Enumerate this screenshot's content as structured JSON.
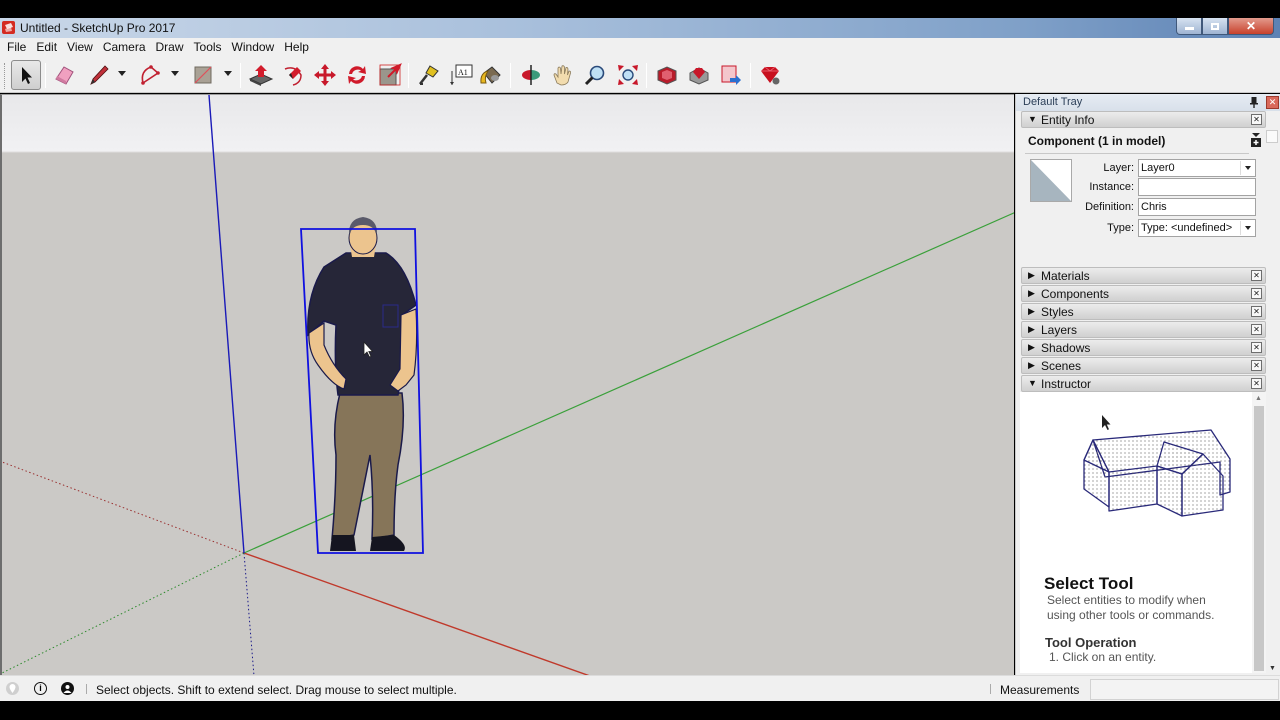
{
  "window": {
    "title": "Untitled - SketchUp Pro 2017",
    "controls": [
      "minimize",
      "restore",
      "close"
    ]
  },
  "menu": {
    "items": [
      "File",
      "Edit",
      "View",
      "Camera",
      "Draw",
      "Tools",
      "Window",
      "Help"
    ]
  },
  "toolbar": {
    "tools": [
      {
        "name": "select-tool",
        "icon": "arrow-cursor-icon",
        "active": true
      },
      {
        "name": "eraser-tool",
        "icon": "eraser-icon"
      },
      {
        "name": "line-tool",
        "icon": "pencil-icon",
        "has_dropdown": true
      },
      {
        "name": "arc-tool",
        "icon": "arc-icon",
        "has_dropdown": true
      },
      {
        "name": "rectangle-tool",
        "icon": "rectangle-icon",
        "has_dropdown": true
      },
      {
        "name": "push-pull-tool",
        "icon": "push-pull-icon"
      },
      {
        "name": "offset-tool",
        "icon": "offset-icon"
      },
      {
        "name": "move-tool",
        "icon": "move-icon"
      },
      {
        "name": "rotate-tool",
        "icon": "rotate-icon"
      },
      {
        "name": "scale-tool",
        "icon": "scale-icon"
      },
      {
        "name": "tape-measure-tool",
        "icon": "tape-measure-icon"
      },
      {
        "name": "text-tool",
        "icon": "text-label-icon",
        "glyph": "A1"
      },
      {
        "name": "paint-bucket-tool",
        "icon": "paint-bucket-icon"
      },
      {
        "name": "orbit-tool",
        "icon": "orbit-icon"
      },
      {
        "name": "pan-tool",
        "icon": "hand-icon"
      },
      {
        "name": "zoom-tool",
        "icon": "magnifier-icon"
      },
      {
        "name": "zoom-extents-tool",
        "icon": "zoom-extents-icon"
      },
      {
        "name": "3d-warehouse",
        "icon": "warehouse-icon"
      },
      {
        "name": "extension-warehouse",
        "icon": "extension-warehouse-icon"
      },
      {
        "name": "send-to-layout",
        "icon": "send-to-layout-icon"
      },
      {
        "name": "extension-manager",
        "icon": "ruby-gem-icon"
      }
    ]
  },
  "viewport": {
    "selected_component": "Chris",
    "axes_colors": {
      "red": "#c0392b",
      "green": "#3aa03a",
      "blue": "#1a1ab8"
    },
    "selection_color": "#1010e0"
  },
  "tray": {
    "title": "Default Tray",
    "entity_info": {
      "label": "Entity Info",
      "heading": "Component (1 in model)",
      "fields": {
        "layer_label": "Layer:",
        "layer_value": "Layer0",
        "instance_label": "Instance:",
        "instance_value": "",
        "definition_label": "Definition:",
        "definition_value": "Chris",
        "type_label": "Type:",
        "type_value": "Type: <undefined>"
      }
    },
    "panels": [
      {
        "label": "Materials",
        "expanded": false
      },
      {
        "label": "Components",
        "expanded": false
      },
      {
        "label": "Styles",
        "expanded": false
      },
      {
        "label": "Layers",
        "expanded": false
      },
      {
        "label": "Shadows",
        "expanded": false
      },
      {
        "label": "Scenes",
        "expanded": false
      },
      {
        "label": "Instructor",
        "expanded": true
      }
    ],
    "instructor": {
      "title": "Select Tool",
      "description": "Select entities to modify when using other tools or commands.",
      "operation_heading": "Tool Operation",
      "operation_step": "1. Click on an entity."
    }
  },
  "statusbar": {
    "message": "Select objects. Shift to extend select. Drag mouse to select multiple.",
    "measurements_label": "Measurements",
    "measurements_value": ""
  }
}
